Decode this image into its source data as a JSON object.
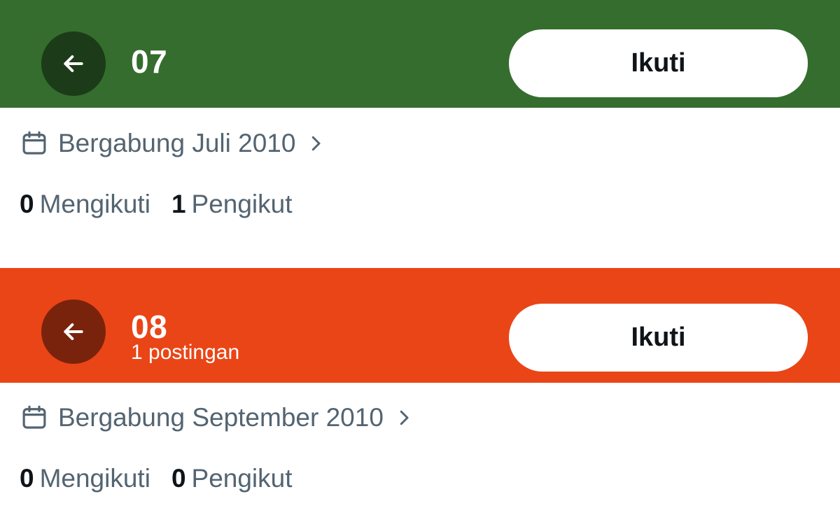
{
  "profiles": [
    {
      "header_color": "#346d2d",
      "back_button_color": "#1c3b18",
      "title": "07",
      "subtitle": "",
      "follow_label": "Ikuti",
      "joined_text": "Bergabung Juli 2010",
      "following_count": "0",
      "following_label": "Mengikuti",
      "followers_count": "1",
      "followers_label": "Pengikut"
    },
    {
      "header_color": "#ea4516",
      "back_button_color": "#7a230c",
      "title": "08",
      "subtitle": "1 postingan",
      "follow_label": "Ikuti",
      "joined_text": "Bergabung September 2010",
      "following_count": "0",
      "following_label": "Mengikuti",
      "followers_count": "0",
      "followers_label": "Pengikut"
    }
  ],
  "icons": {
    "back": "arrow-left-icon",
    "joined": "calendar-icon",
    "more": "chevron-right-icon"
  },
  "colors": {
    "secondary_text": "#536471",
    "primary_text": "#0f1419"
  }
}
